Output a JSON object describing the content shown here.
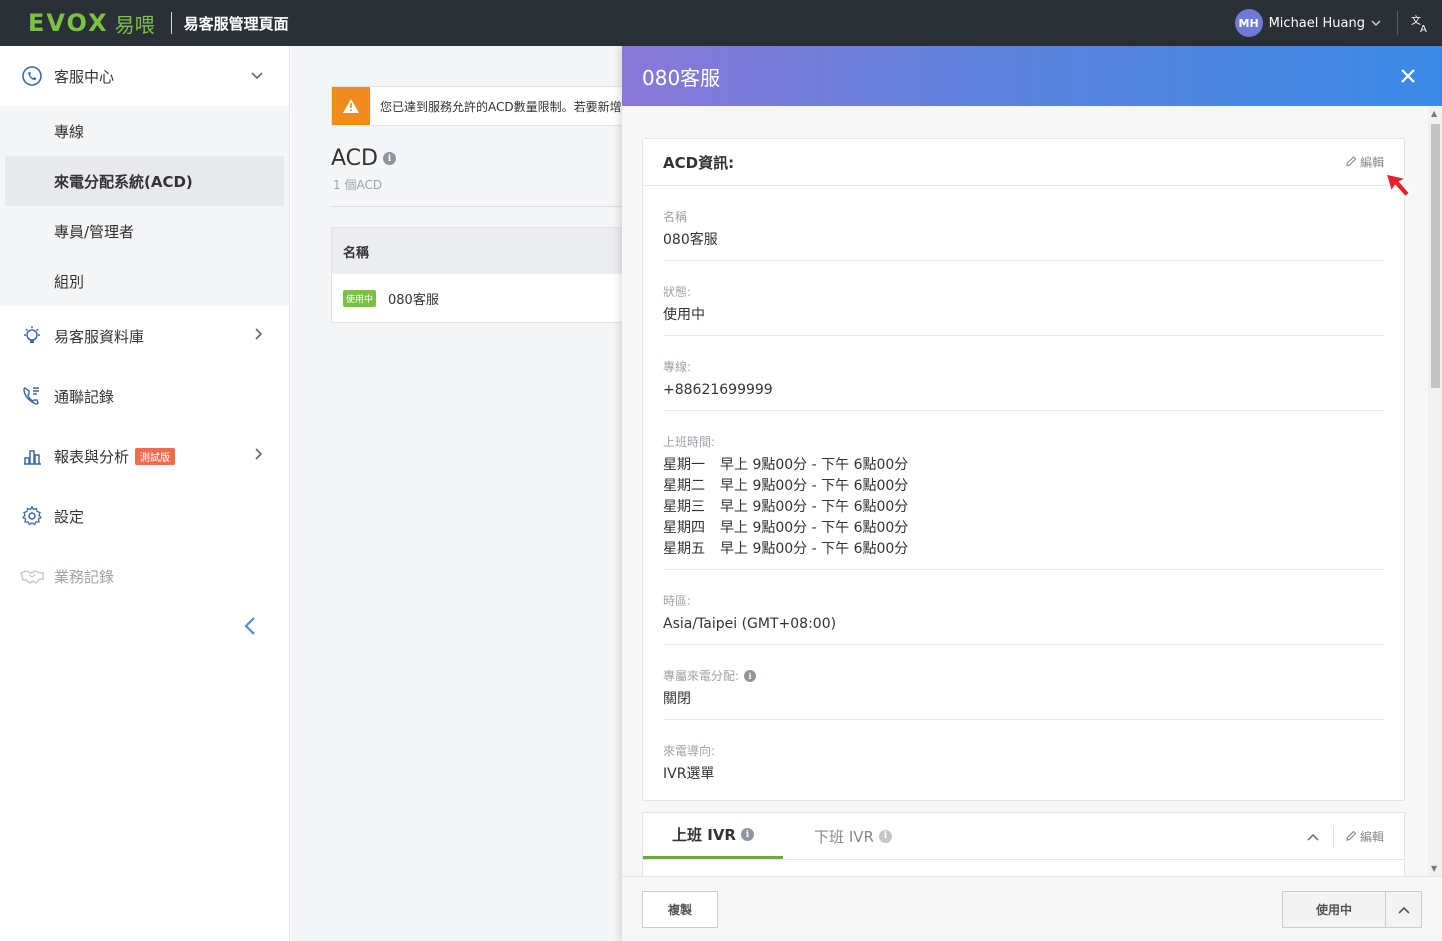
{
  "topbar": {
    "logo_text": "EVOX",
    "logo_cn": "易喂",
    "app_title": "易客服管理頁面",
    "user_initials": "MH",
    "user_name": "Michael Huang",
    "lang_icon": "translate-icon"
  },
  "sidebar": {
    "group": {
      "label": "客服中心",
      "icon": "headset-icon",
      "expanded": true,
      "items": [
        {
          "label": "專線",
          "active": false
        },
        {
          "label": "來電分配系統(ACD)",
          "active": true
        },
        {
          "label": "專員/管理者",
          "active": false
        },
        {
          "label": "組別",
          "active": false
        }
      ]
    },
    "items": [
      {
        "label": "易客服資料庫",
        "icon": "lightbulb-icon",
        "has_children": true
      },
      {
        "label": "通聯記錄",
        "icon": "phone-log-icon",
        "has_children": false
      },
      {
        "label": "報表與分析",
        "icon": "bar-chart-icon",
        "badge": "測試版",
        "has_children": true
      },
      {
        "label": "設定",
        "icon": "gear-icon",
        "has_children": false
      },
      {
        "label": "業務記錄",
        "icon": "handshake-icon",
        "has_children": false,
        "disabled": true
      }
    ]
  },
  "main": {
    "alert_text": "您已達到服務允許的ACD數量限制。若要新增A",
    "title": "ACD",
    "subtitle": "1 個ACD",
    "table": {
      "header": "名稱",
      "rows": [
        {
          "status": "使用中",
          "name": "080客服"
        }
      ]
    }
  },
  "drawer": {
    "title": "080客服",
    "acd_card": {
      "title": "ACD資訊:",
      "edit_label": "編輯",
      "fields": {
        "name_label": "名稱",
        "name_value": "080客服",
        "status_label": "狀態:",
        "status_value": "使用中",
        "line_label": "專線:",
        "line_value": "+88621699999",
        "hours_label": "上班時間:",
        "hours": [
          {
            "day": "星期一",
            "time": "早上 9點00分 - 下午 6點00分"
          },
          {
            "day": "星期二",
            "time": "早上 9點00分 - 下午 6點00分"
          },
          {
            "day": "星期三",
            "time": "早上 9點00分 - 下午 6點00分"
          },
          {
            "day": "星期四",
            "time": "早上 9點00分 - 下午 6點00分"
          },
          {
            "day": "星期五",
            "time": "早上 9點00分 - 下午 6點00分"
          }
        ],
        "tz_label": "時區:",
        "tz_value": "Asia/Taipei (GMT+08:00)",
        "dedicated_label": "專屬來電分配:",
        "dedicated_value": "關閉",
        "routing_label": "來電導向:",
        "routing_value": "IVR選單"
      }
    },
    "ivr_card": {
      "tabs": [
        {
          "label": "上班 IVR",
          "active": true
        },
        {
          "label": "下班 IVR",
          "active": false
        }
      ],
      "edit_label": "編輯"
    },
    "footer": {
      "copy_label": "複製",
      "status_label": "使用中"
    }
  },
  "colors": {
    "topbar_bg": "#2b2f36",
    "brand_green": "#7cc242",
    "alert_orange": "#f28b1e",
    "beta_red": "#f26b4e",
    "drawer_gradient_start": "#8a78d9",
    "drawer_gradient_end": "#3a8ae6",
    "tab_active": "#6aaa3a"
  }
}
